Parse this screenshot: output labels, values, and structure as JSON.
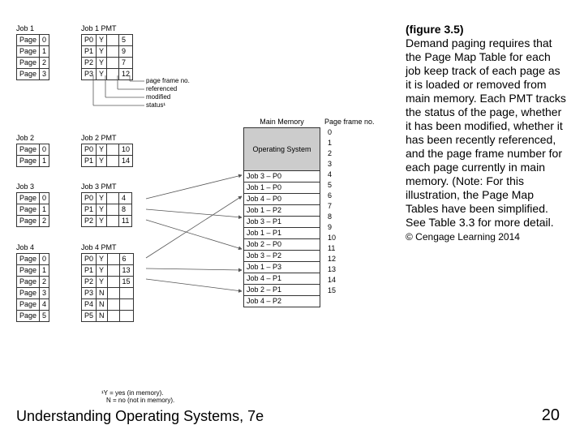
{
  "job1": {
    "label": "Job 1",
    "rows": [
      [
        "Page",
        "0"
      ],
      [
        "Page",
        "1"
      ],
      [
        "Page",
        "2"
      ],
      [
        "Page",
        "3"
      ]
    ]
  },
  "pmt1": {
    "label": "Job 1 PMT",
    "rows": [
      [
        "P0",
        "Y",
        "",
        "5"
      ],
      [
        "P1",
        "Y",
        "",
        "9"
      ],
      [
        "P2",
        "Y",
        "",
        "7"
      ],
      [
        "P3",
        "Y",
        "",
        "12"
      ]
    ]
  },
  "job2": {
    "label": "Job 2",
    "rows": [
      [
        "Page",
        "0"
      ],
      [
        "Page",
        "1"
      ]
    ]
  },
  "pmt2": {
    "label": "Job 2 PMT",
    "rows": [
      [
        "P0",
        "Y",
        "",
        "10"
      ],
      [
        "P1",
        "Y",
        "",
        "14"
      ]
    ]
  },
  "job3": {
    "label": "Job 3",
    "rows": [
      [
        "Page",
        "0"
      ],
      [
        "Page",
        "1"
      ],
      [
        "Page",
        "2"
      ]
    ]
  },
  "pmt3": {
    "label": "Job 3 PMT",
    "rows": [
      [
        "P0",
        "Y",
        "",
        "4"
      ],
      [
        "P1",
        "Y",
        "",
        "8"
      ],
      [
        "P2",
        "Y",
        "",
        "11"
      ]
    ]
  },
  "job4": {
    "label": "Job 4",
    "rows": [
      [
        "Page",
        "0"
      ],
      [
        "Page",
        "1"
      ],
      [
        "Page",
        "2"
      ],
      [
        "Page",
        "3"
      ],
      [
        "Page",
        "4"
      ],
      [
        "Page",
        "5"
      ]
    ]
  },
  "pmt4": {
    "label": "Job 4 PMT",
    "rows": [
      [
        "P0",
        "Y",
        "",
        "6"
      ],
      [
        "P1",
        "Y",
        "",
        "13"
      ],
      [
        "P2",
        "Y",
        "",
        "15"
      ],
      [
        "P3",
        "N",
        "",
        ""
      ],
      [
        "P4",
        "N",
        "",
        ""
      ],
      [
        "P5",
        "N",
        "",
        ""
      ]
    ]
  },
  "mm": {
    "label": "Main Memory",
    "pfn_label": "Page frame no.",
    "os": "Operating System",
    "rows": [
      "Job 3 – P0",
      "Job 1 – P0",
      "Job 4 – P0",
      "Job 1 – P2",
      "Job 3 – P1",
      "Job 1 – P1",
      "Job 2 – P0",
      "Job 3 – P2",
      "Job 1 – P3",
      "Job 4 – P1",
      "Job 2 – P1",
      "Job 4 – P2"
    ],
    "nums": [
      "0",
      "1",
      "2",
      "3",
      "4",
      "5",
      "6",
      "7",
      "8",
      "9",
      "10",
      "11",
      "12",
      "13",
      "14",
      "15"
    ]
  },
  "annot": {
    "l1": "page frame no.",
    "l2": "referenced",
    "l3": "modified",
    "l4": "status¹"
  },
  "footnote": {
    "l1": "¹Y = yes (in memory).",
    "l2": "N = no (not in memory)."
  },
  "caption": {
    "title": "(figure 3.5)",
    "body": "Demand paging requires that the Page Map Table for each job keep track of each page as it is loaded or removed from main memory. Each PMT tracks the status of the page, whether it has been modified, whether it has been recently referenced, and the page frame number for each page currently in main memory. (Note: For this illustration, the Page Map Tables have been simplified. See Table 3.3 for more detail.",
    "copy": "© Cengage Learning 2014"
  },
  "footer": {
    "left": "Understanding Operating Systems, 7e",
    "right": "20"
  }
}
